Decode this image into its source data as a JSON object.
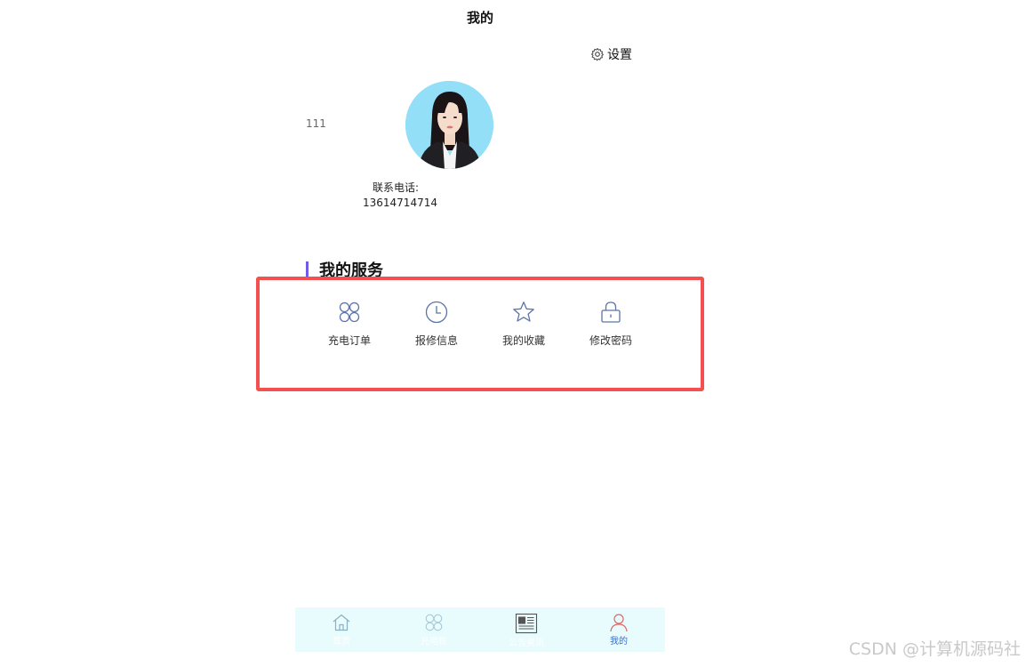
{
  "header": {
    "title": "我的"
  },
  "settings": {
    "label": "设置",
    "icon": "gear-icon"
  },
  "profile": {
    "user_id": "111",
    "phone_label": "联系电话:",
    "phone_value": "13614714714"
  },
  "services": {
    "title": "我的服务",
    "accent_color": "#6f5ce8",
    "highlight_color": "#f55050",
    "items": [
      {
        "label": "充电订单",
        "icon": "grid-circles-icon"
      },
      {
        "label": "报修信息",
        "icon": "clock-icon"
      },
      {
        "label": "我的收藏",
        "icon": "star-icon"
      },
      {
        "label": "修改密码",
        "icon": "lock-icon"
      }
    ]
  },
  "tabbar": {
    "background": "#e8fbfd",
    "tabs": [
      {
        "label": "首页",
        "icon": "home-icon",
        "active": false
      },
      {
        "label": "充电桩",
        "icon": "grid-circles-icon",
        "active": false
      },
      {
        "label": "公告资讯",
        "icon": "news-icon",
        "active": false
      },
      {
        "label": "我的",
        "icon": "user-icon",
        "active": true
      }
    ]
  },
  "watermark": {
    "text": "CSDN @计算机源码社"
  }
}
